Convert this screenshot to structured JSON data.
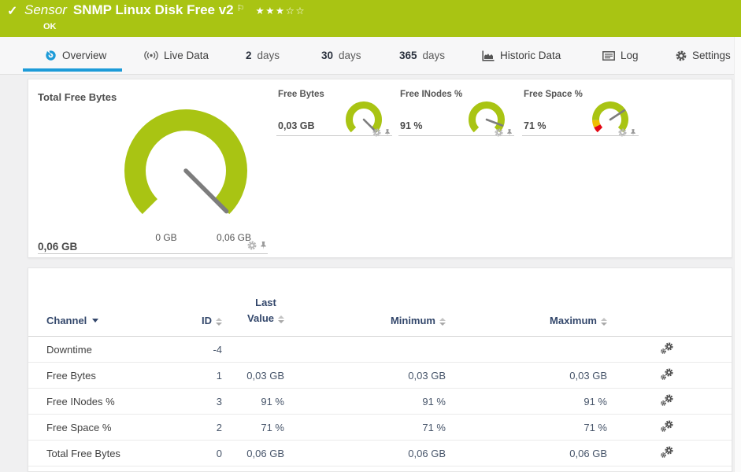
{
  "colors": {
    "green": "#a9c413",
    "accent_blue": "#1d9bd8",
    "red": "#e30613",
    "yellow": "#eebf00",
    "needle": "#7d7d7d",
    "table_header": "#33476b"
  },
  "header": {
    "check_icon": "✓",
    "kind": "Sensor",
    "title": "SNMP Linux Disk Free v2",
    "flag_icon": "⚐",
    "stars": "★★★☆☆",
    "status": "OK"
  },
  "tabs": {
    "overview": {
      "label": "Overview"
    },
    "live": {
      "label": "Live Data"
    },
    "d2": {
      "num": "2",
      "unit": "days"
    },
    "d30": {
      "num": "30",
      "unit": "days"
    },
    "d365": {
      "num": "365",
      "unit": "days"
    },
    "historic": {
      "label": "Historic Data"
    },
    "log": {
      "label": "Log"
    },
    "settings": {
      "label": "Settings"
    }
  },
  "gauges": {
    "main": {
      "title": "Total Free Bytes",
      "value": "0,06 GB",
      "min_label": "0 GB",
      "max_label": "0,06 GB",
      "fraction": 1,
      "segments": [
        {
          "from": 0,
          "to": 1,
          "color": "#a9c413"
        }
      ]
    },
    "small": [
      {
        "title": "Free Bytes",
        "value": "0,03 GB",
        "fraction": 1,
        "segments": [
          {
            "from": 0,
            "to": 1,
            "color": "#a9c413"
          }
        ]
      },
      {
        "title": "Free INodes %",
        "value": "91 %",
        "fraction": 0.91,
        "segments": [
          {
            "from": 0,
            "to": 1,
            "color": "#a9c413"
          }
        ]
      },
      {
        "title": "Free Space %",
        "value": "71 %",
        "fraction": 0.71,
        "segments": [
          {
            "from": 0,
            "to": 0.07,
            "color": "#e30613"
          },
          {
            "from": 0.07,
            "to": 0.16,
            "color": "#eebf00"
          },
          {
            "from": 0.16,
            "to": 1,
            "color": "#a9c413"
          }
        ]
      }
    ]
  },
  "table": {
    "columns": {
      "channel": "Channel",
      "id": "ID",
      "last_line1": "Last",
      "last_line2": "Value",
      "minimum": "Minimum",
      "maximum": "Maximum"
    },
    "rows": [
      {
        "channel": "Downtime",
        "id": "-4",
        "last": "",
        "min": "",
        "max": ""
      },
      {
        "channel": "Free Bytes",
        "id": "1",
        "last": "0,03 GB",
        "min": "0,03 GB",
        "max": "0,03 GB"
      },
      {
        "channel": "Free INodes %",
        "id": "3",
        "last": "91 %",
        "min": "91 %",
        "max": "91 %"
      },
      {
        "channel": "Free Space %",
        "id": "2",
        "last": "71 %",
        "min": "71 %",
        "max": "71 %"
      },
      {
        "channel": "Total Free Bytes",
        "id": "0",
        "last": "0,06 GB",
        "min": "0,06 GB",
        "max": "0,06 GB"
      }
    ]
  }
}
